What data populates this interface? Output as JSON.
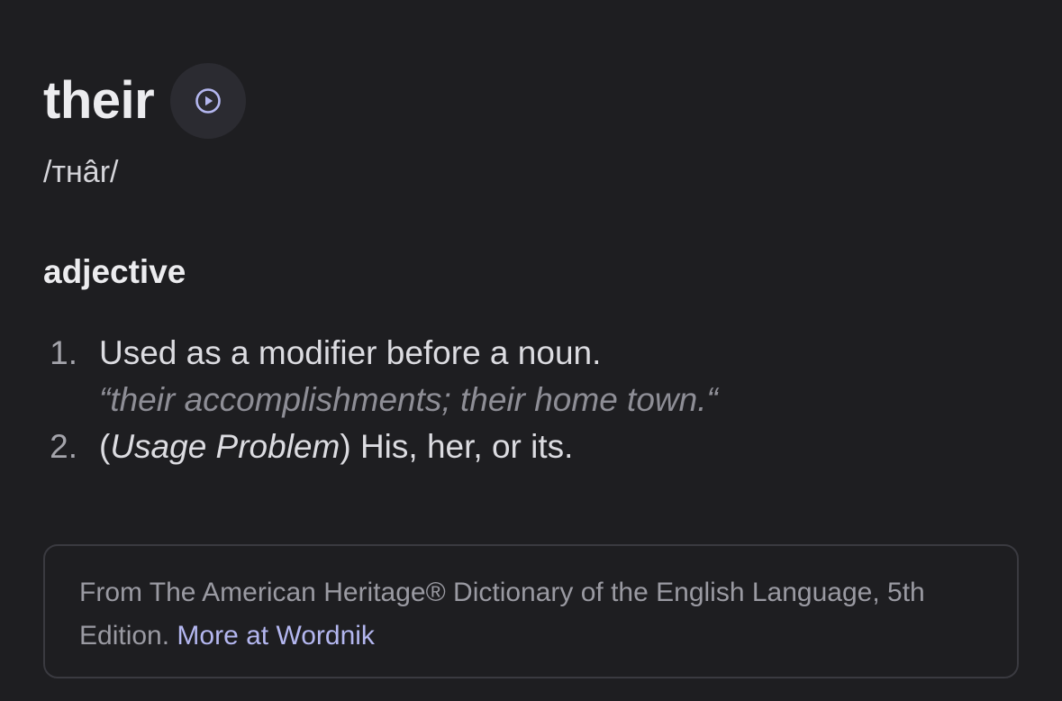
{
  "entry": {
    "word": "their",
    "phonetic": "/тнâr/",
    "part_of_speech": "adjective",
    "play_icon": "play-circle-icon",
    "accent_color": "#b4b7f0"
  },
  "definitions": [
    {
      "number": "1.",
      "text": "Used as a modifier before a noun.",
      "example": "“their accomplishments; their home town.“"
    },
    {
      "number": "2.",
      "open_paren": "(",
      "usage_label": "Usage Problem",
      "close_paren": ")",
      "text": " His, her, or its."
    }
  ],
  "source": {
    "text": "From The American Heritage® Dictionary of the English Language, 5th Edition. ",
    "link_label": "More at Wordnik"
  }
}
